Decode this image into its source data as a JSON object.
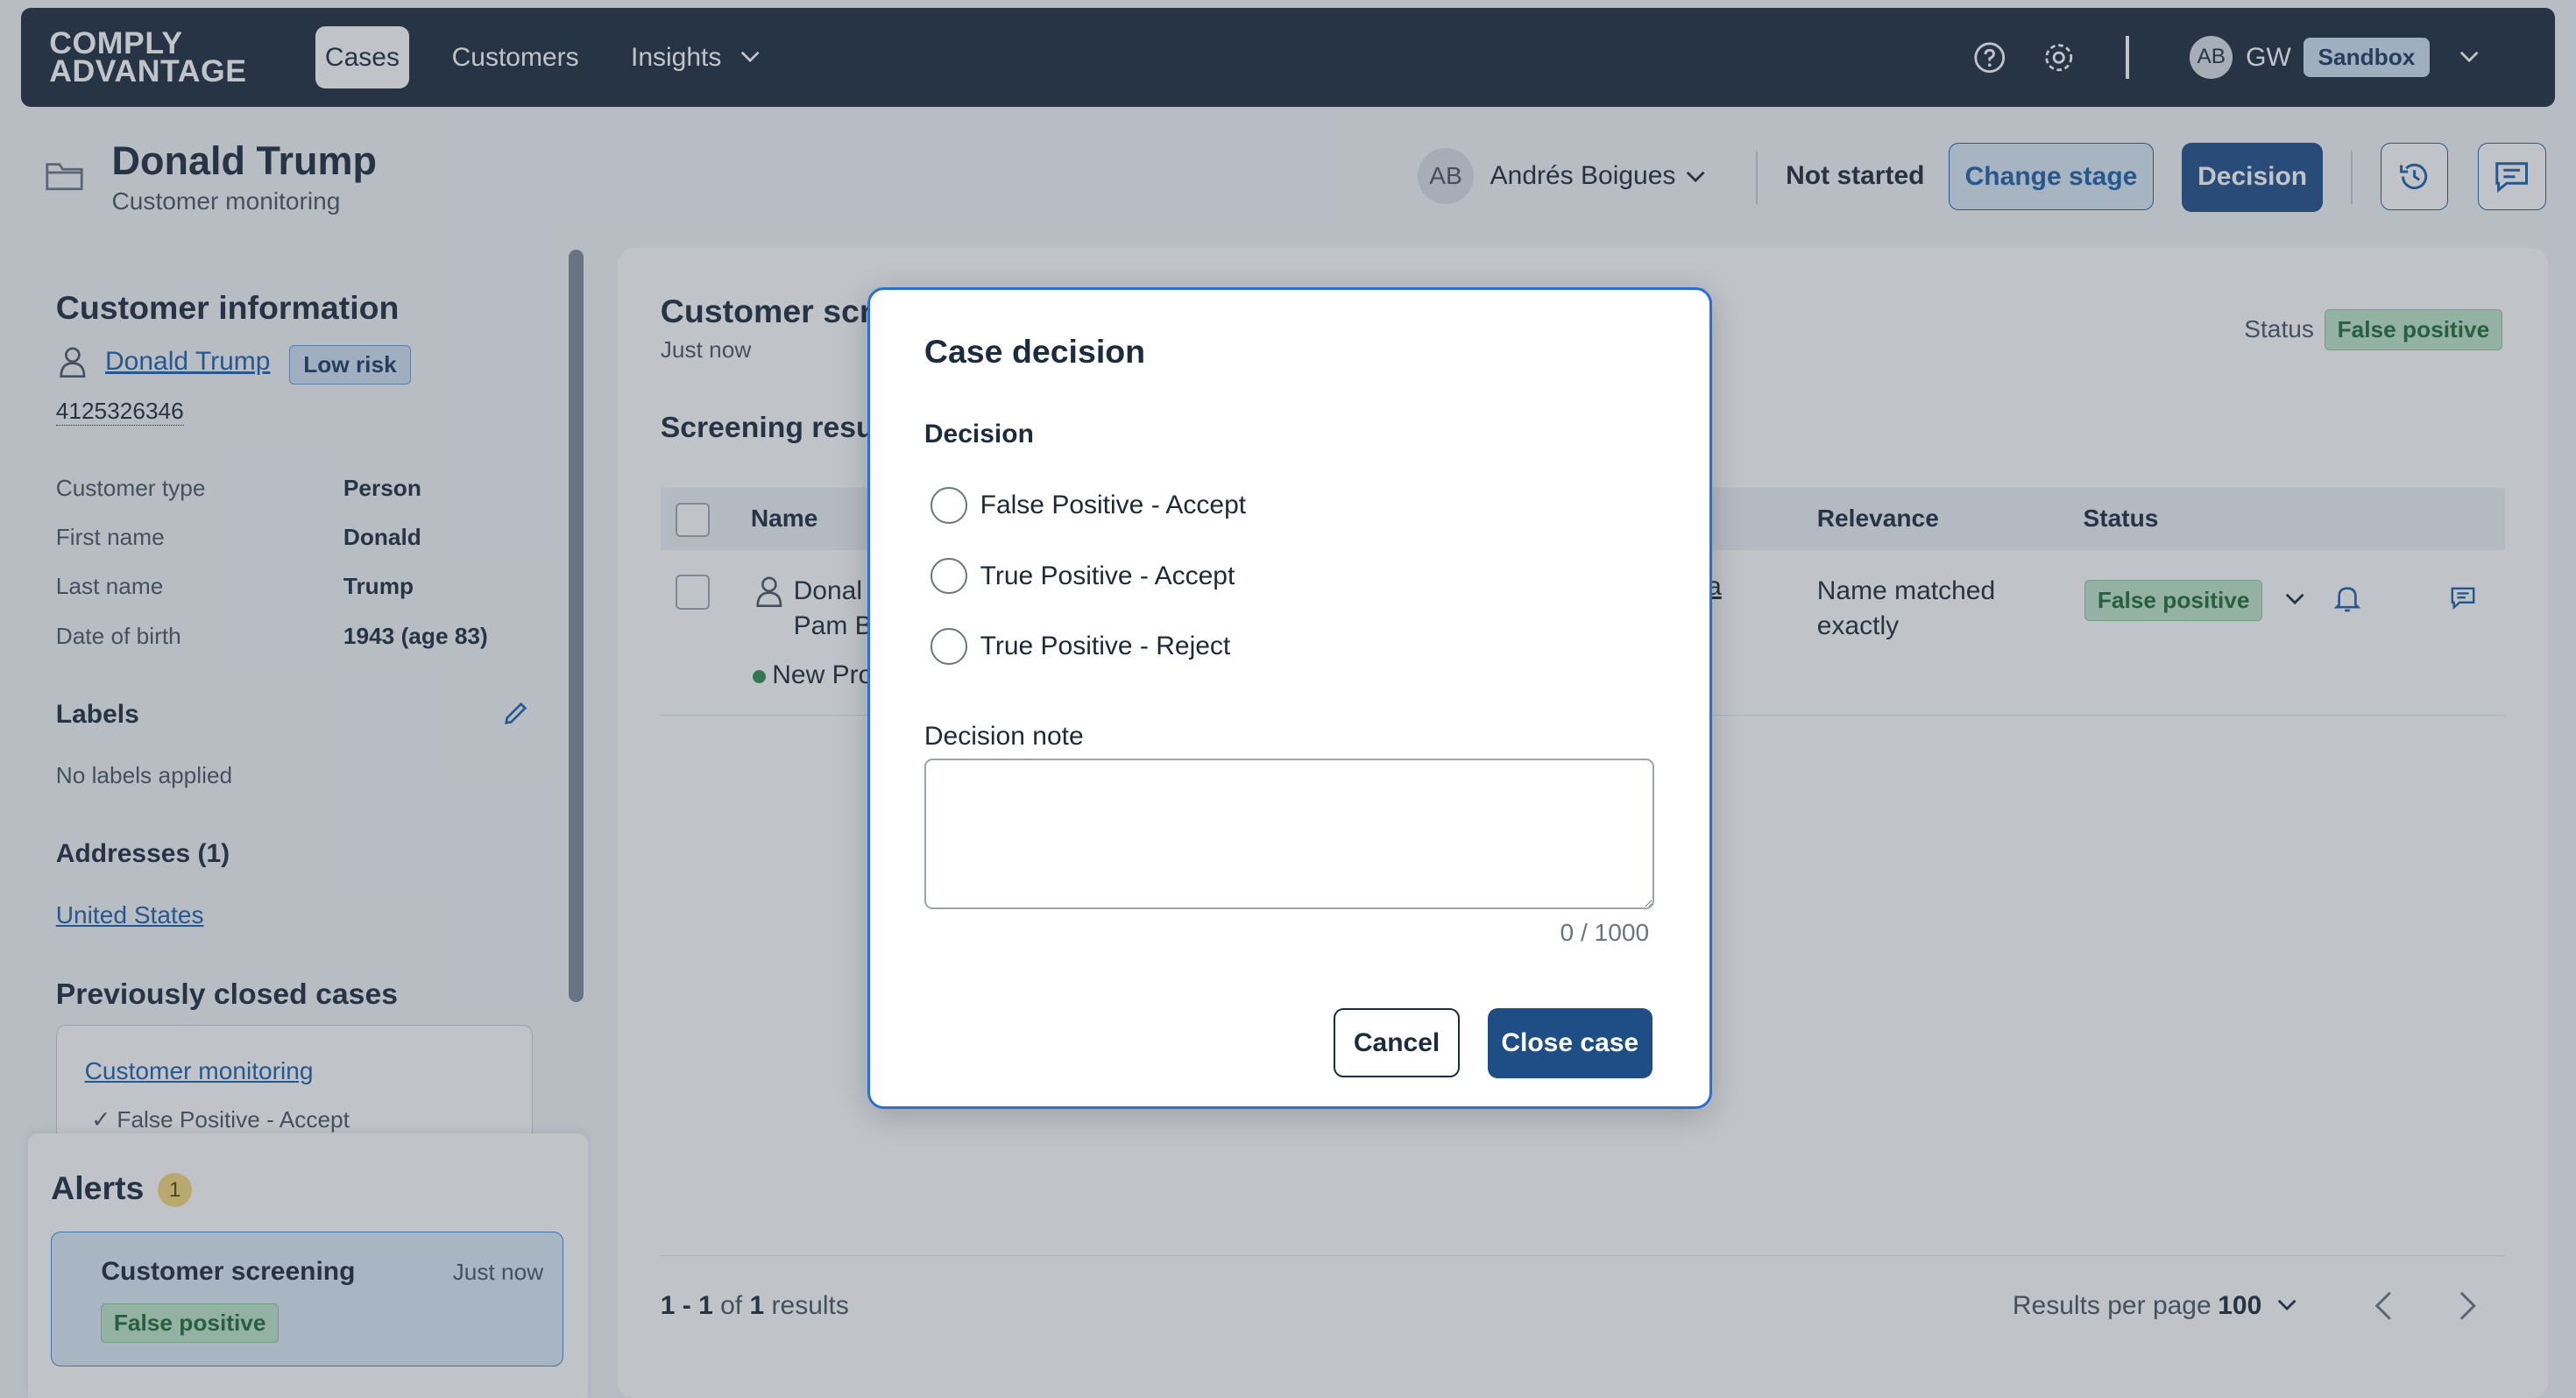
{
  "nav": {
    "logo_line1": "COMPLY",
    "logo_line2": "ADVANTAGE",
    "cases": "Cases",
    "customers": "Customers",
    "insights": "Insights",
    "user_avatar": "AB",
    "user_initials": "GW",
    "environment": "Sandbox"
  },
  "header": {
    "title": "Donald Trump",
    "subtitle": "Customer monitoring",
    "assignee_avatar": "AB",
    "assignee": "Andrés Boigues",
    "status": "Not started",
    "change_stage": "Change stage",
    "decision": "Decision"
  },
  "customer_info": {
    "heading": "Customer information",
    "name": "Donald Trump",
    "risk": "Low risk",
    "customer_id": "4125326346",
    "fields": [
      {
        "label": "Customer type",
        "value": "Person"
      },
      {
        "label": "First name",
        "value": "Donald"
      },
      {
        "label": "Last name",
        "value": "Trump"
      },
      {
        "label": "Date of birth",
        "value": "1943 (age 83)"
      }
    ],
    "labels_heading": "Labels",
    "labels_empty": "No labels applied",
    "addresses_heading": "Addresses (1)",
    "address": "United States",
    "prev_cases_heading": "Previously closed cases",
    "prev_case_link": "Customer monitoring",
    "prev_case_result": "False Positive - Accept"
  },
  "alerts": {
    "heading": "Alerts",
    "count": "1",
    "item_title": "Customer screening",
    "item_time": "Just now",
    "item_status": "False positive"
  },
  "screening": {
    "title": "Customer scr",
    "time": "Just now",
    "status_label": "Status",
    "status_value": "False positive",
    "results_heading": "Screening resu",
    "col_name": "Name",
    "col_partial": "s",
    "col_relevance": "Relevance",
    "col_status": "Status",
    "row_name1": "Donal",
    "row_name2": "Pam B",
    "row_new": "New Pro",
    "row_partial": "a",
    "row_relevance1": "Name matched",
    "row_relevance2": "exactly",
    "row_status": "False positive",
    "pager_range": "1 - 1",
    "pager_of": "of",
    "pager_total": "1",
    "pager_results": "results",
    "per_page_label": "Results per page",
    "per_page_value": "100"
  },
  "modal": {
    "title": "Case decision",
    "decision_label": "Decision",
    "options": [
      "False Positive - Accept",
      "True Positive - Accept",
      "True Positive - Reject"
    ],
    "note_label": "Decision note",
    "note_value": "",
    "char_count": "0 / 1000",
    "cancel": "Cancel",
    "close_case": "Close case"
  }
}
